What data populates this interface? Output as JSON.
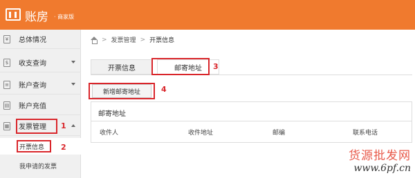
{
  "header": {
    "logo_text": "账房",
    "logo_sub": "· 商家版"
  },
  "sidebar": {
    "items": [
      {
        "label": "总体情况",
        "icon": "yen-icon"
      },
      {
        "label": "收支查询",
        "icon": "receipt-icon"
      },
      {
        "label": "账户查询",
        "icon": "ledger-icon"
      },
      {
        "label": "账户充值",
        "icon": "wallet-icon"
      },
      {
        "label": "发票管理",
        "icon": "invoice-icon"
      }
    ],
    "sub_items": [
      {
        "label": "开票信息"
      },
      {
        "label": "我申请的发票"
      }
    ]
  },
  "breadcrumb": {
    "level1": "发票管理",
    "sep": ">",
    "current": "开票信息"
  },
  "tabs": [
    {
      "label": "开票信息"
    },
    {
      "label": "邮寄地址"
    }
  ],
  "actions": {
    "add_address": "新增邮寄地址"
  },
  "panel": {
    "title": "邮寄地址",
    "columns": [
      "收件人",
      "收件地址",
      "邮编",
      "联系电话"
    ]
  },
  "annotations": [
    "1",
    "2",
    "3",
    "4"
  ],
  "watermark": {
    "text": "货源批发网",
    "url": "www.6pf.cn"
  },
  "colors": {
    "brand": "#f07a2e",
    "annotation": "#d9252a"
  }
}
